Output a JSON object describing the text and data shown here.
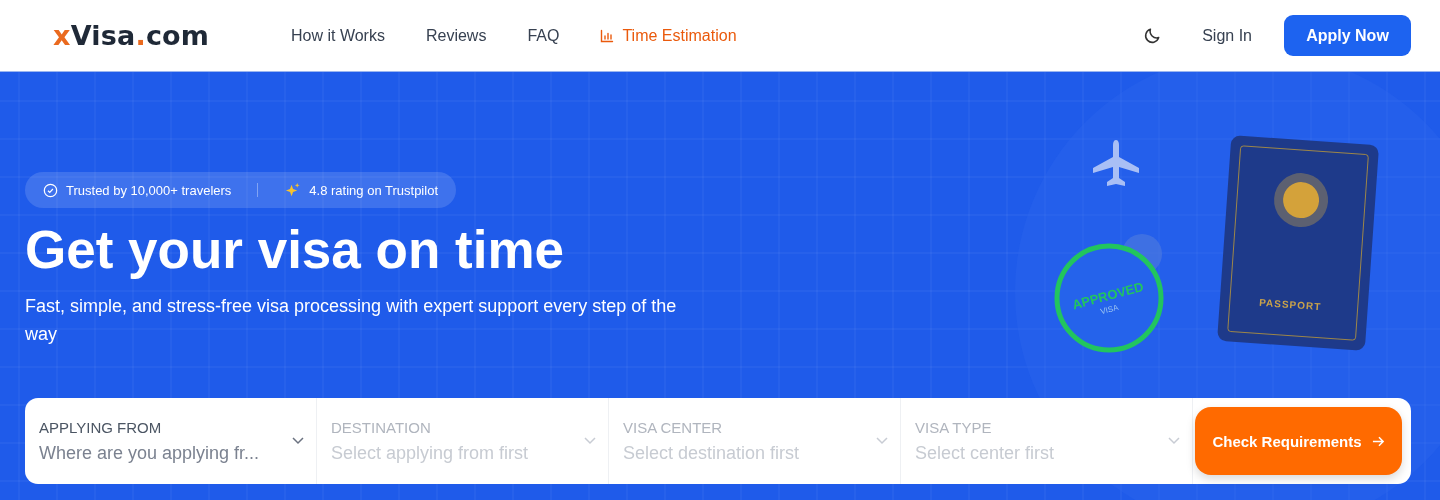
{
  "logo": {
    "prefix": "x",
    "name": "Visa",
    "dot": ".",
    "suffix": "com"
  },
  "nav": [
    {
      "kind": "link",
      "label": "How it Works",
      "selected": false
    },
    {
      "kind": "link",
      "label": "Reviews",
      "selected": false
    },
    {
      "kind": "link",
      "label": "FAQ",
      "selected": false
    },
    {
      "kind": "chart",
      "label": "Time Estimation",
      "selected": true
    }
  ],
  "header_actions": {
    "sign_in": "Sign In",
    "apply": "Apply Now"
  },
  "hero": {
    "trust_badges": [
      {
        "kind": "check",
        "text": "Trusted by 10,000+ travelers"
      },
      {
        "kind": "sparkle",
        "text": "4.8 rating on Trustpilot"
      }
    ],
    "title": "Get your visa on time",
    "subtitle": "Fast, simple, and stress-free visa processing with expert support every step of the way",
    "illustration": {
      "stamp_text": "APPROVED",
      "stamp_subtext": "VISA",
      "passport_text": "PASSPORT"
    }
  },
  "search": {
    "fields": [
      {
        "label": "APPLYING FROM",
        "placeholder": "Where are you applying fr...",
        "disabled": false
      },
      {
        "label": "DESTINATION",
        "placeholder": "Select applying from first",
        "disabled": true
      },
      {
        "label": "VISA CENTER",
        "placeholder": "Select destination first",
        "disabled": true
      },
      {
        "label": "VISA TYPE",
        "placeholder": "Select center first",
        "disabled": true
      }
    ],
    "button": "Check Requirements"
  }
}
